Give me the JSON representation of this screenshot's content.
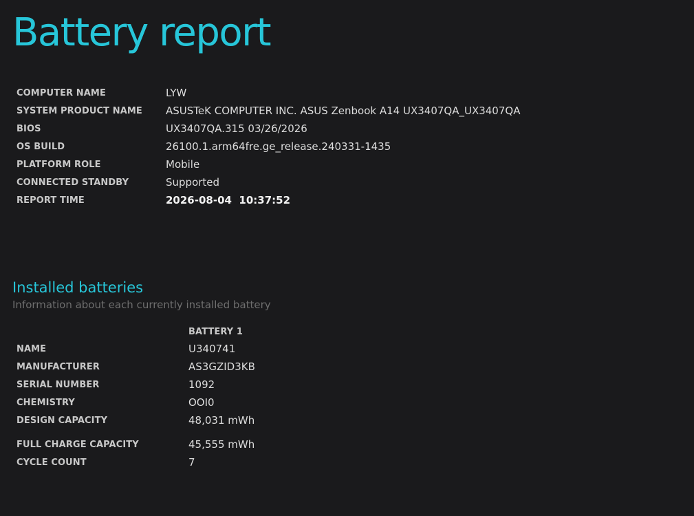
{
  "title": "Battery report",
  "system": {
    "rows": [
      {
        "label": "COMPUTER NAME",
        "value": "LYW"
      },
      {
        "label": "SYSTEM PRODUCT NAME",
        "value": "ASUSTeK COMPUTER INC. ASUS Zenbook A14 UX3407QA_UX3407QA"
      },
      {
        "label": "BIOS",
        "value": "UX3407QA.315 03/26/2026"
      },
      {
        "label": "OS BUILD",
        "value": "26100.1.arm64fre.ge_release.240331-1435"
      },
      {
        "label": "PLATFORM ROLE",
        "value": "Mobile"
      },
      {
        "label": "CONNECTED STANDBY",
        "value": "Supported"
      },
      {
        "label": "REPORT TIME",
        "value": "2026-08-04  10:37:52"
      }
    ]
  },
  "installed": {
    "title": "Installed batteries",
    "subtitle": "Information about each currently installed battery",
    "column_header": "BATTERY 1",
    "rows": [
      {
        "label": "NAME",
        "value": "U340741"
      },
      {
        "label": "MANUFACTURER",
        "value": "AS3GZID3KB"
      },
      {
        "label": "SERIAL NUMBER",
        "value": "1092"
      },
      {
        "label": "CHEMISTRY",
        "value": "OOI0"
      },
      {
        "label": "DESIGN CAPACITY",
        "value": "48,031 mWh"
      },
      {
        "label": "FULL CHARGE CAPACITY",
        "value": "45,555 mWh"
      },
      {
        "label": "CYCLE COUNT",
        "value": "7"
      }
    ]
  }
}
